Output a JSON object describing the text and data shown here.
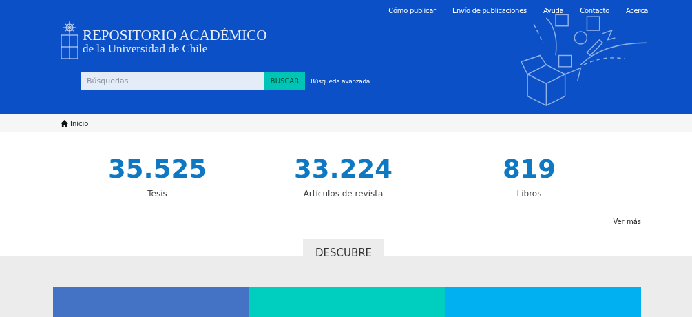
{
  "top_nav": [
    {
      "label": "Cómo publicar"
    },
    {
      "label": "Envío de publicaciones"
    },
    {
      "label": "Ayuda"
    },
    {
      "label": "Contacto"
    },
    {
      "label": "Acerca"
    }
  ],
  "logo": {
    "title": "REPOSITORIO ACADÉMICO",
    "subtitle": "de la Universidad de Chile"
  },
  "search": {
    "placeholder": "Búsquedas",
    "button": "BUSCAR",
    "advanced_link": "Búsqueda avanzada"
  },
  "breadcrumb": {
    "label": "Inicio"
  },
  "stats": [
    {
      "value": "35.525",
      "label": "Tesis"
    },
    {
      "value": "33.224",
      "label": "Artículos de revista"
    },
    {
      "value": "819",
      "label": "Libros"
    }
  ],
  "more_link": "Ver más",
  "discover": {
    "tab": "DESCUBRE",
    "cards": [
      {
        "color": "#4472c4"
      },
      {
        "color": "#00cfbf"
      },
      {
        "color": "#00b0f0"
      }
    ]
  }
}
